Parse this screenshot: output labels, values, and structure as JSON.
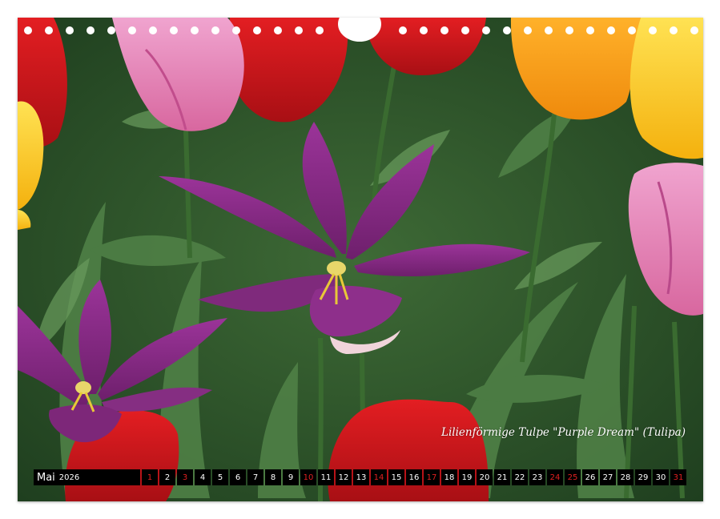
{
  "calendar": {
    "month": "Mai",
    "year": "2026",
    "caption": "Lilienförmige Tulpe \"Purple Dream\" (Tulipa)",
    "days": [
      {
        "n": "1",
        "red": true
      },
      {
        "n": "2",
        "red": false
      },
      {
        "n": "3",
        "red": true
      },
      {
        "n": "4",
        "red": false
      },
      {
        "n": "5",
        "red": false
      },
      {
        "n": "6",
        "red": false
      },
      {
        "n": "7",
        "red": false
      },
      {
        "n": "8",
        "red": false
      },
      {
        "n": "9",
        "red": false
      },
      {
        "n": "10",
        "red": true
      },
      {
        "n": "11",
        "red": false
      },
      {
        "n": "12",
        "red": false
      },
      {
        "n": "13",
        "red": false
      },
      {
        "n": "14",
        "red": true
      },
      {
        "n": "15",
        "red": false
      },
      {
        "n": "16",
        "red": false
      },
      {
        "n": "17",
        "red": true
      },
      {
        "n": "18",
        "red": false
      },
      {
        "n": "19",
        "red": false
      },
      {
        "n": "20",
        "red": false
      },
      {
        "n": "21",
        "red": false
      },
      {
        "n": "22",
        "red": false
      },
      {
        "n": "23",
        "red": false
      },
      {
        "n": "24",
        "red": true
      },
      {
        "n": "25",
        "red": true
      },
      {
        "n": "26",
        "red": false
      },
      {
        "n": "27",
        "red": false
      },
      {
        "n": "28",
        "red": false
      },
      {
        "n": "29",
        "red": false
      },
      {
        "n": "30",
        "red": false
      },
      {
        "n": "31",
        "red": true
      }
    ]
  },
  "colors": {
    "holiday_red": "#e02020",
    "bar_background": "#000000",
    "tulip_purple": "#8a2a86"
  }
}
